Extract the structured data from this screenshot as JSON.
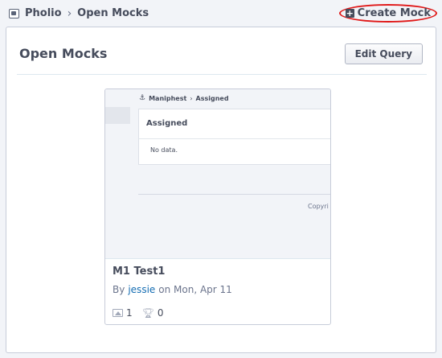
{
  "breadcrumb": {
    "app_icon": "pholio-icon",
    "app": "Pholio",
    "separator": "›",
    "current": "Open Mocks"
  },
  "actions": {
    "create_icon": "plus-square-icon",
    "create_label": "Create Mock"
  },
  "panel": {
    "title": "Open Mocks",
    "edit_query_label": "Edit Query"
  },
  "mock": {
    "thumbnail": {
      "crumb_icon": "anchor-icon",
      "crumb_app": "Maniphest",
      "crumb_sep": "›",
      "crumb_current": "Assigned",
      "box_title": "Assigned",
      "empty_text": "No data.",
      "footer_text": "Copyri"
    },
    "title": "M1 Test1",
    "by_prefix": "By",
    "author": "jessie",
    "date_text": "on Mon, Apr 11",
    "image_count": "1",
    "token_count": "0",
    "image_icon": "image-icon",
    "token_icon": "trophy-icon"
  },
  "colors": {
    "highlight_ring": "#e01919",
    "link": "#136cb2",
    "text": "#464c5c"
  }
}
